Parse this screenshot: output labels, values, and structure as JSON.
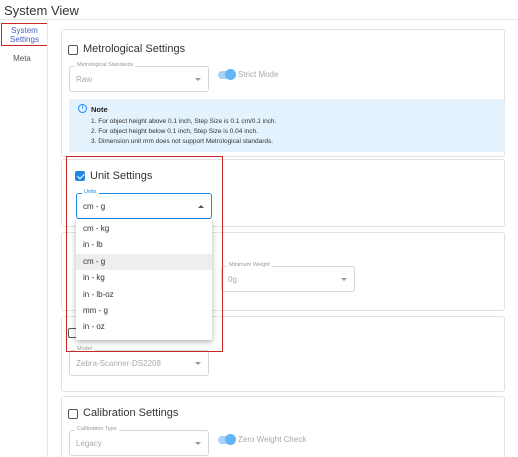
{
  "page_title": "System View",
  "sidebar": {
    "items": [
      {
        "label_line1": "System",
        "label_line2": "Settings"
      },
      {
        "label": "Meta"
      }
    ]
  },
  "metrological": {
    "title": "Metrological Settings",
    "standards_label": "Metrological Standards",
    "standards_value": "Raw",
    "strict_mode_label": "Strict Mode"
  },
  "note": {
    "title": "Note",
    "lines": [
      "1. For object height above 0.1 inch, Step Size is 0.1 cm/0.1 inch.",
      "2. For object height below 0.1 inch, Step Size is 0.04 inch.",
      "3. Dimension unit mm does not support Metrological standards."
    ]
  },
  "unit_settings": {
    "title": "Unit Settings",
    "units_label": "Units",
    "units_value": "cm - g",
    "checked": true
  },
  "units_dropdown": {
    "options": [
      "cm - kg",
      "in - lb",
      "cm - g",
      "in - kg",
      "in - lb-oz",
      "mm - g",
      "in - oz"
    ],
    "selected": "cm - g"
  },
  "weight_section": {
    "min_weight_label": "Minimum Weight",
    "min_weight_value": "0g"
  },
  "scanner_section": {
    "model_label": "Model",
    "model_value": "Zebra-Scanner-DS2208"
  },
  "calibration": {
    "title": "Calibration Settings",
    "type_label": "Calibration Type",
    "type_value": "Legacy",
    "zero_weight_label": "Zero Weight Check"
  },
  "colors": {
    "accent": "#1e88e5",
    "highlight": "#c62828",
    "note_bg": "#e3f2fd"
  }
}
